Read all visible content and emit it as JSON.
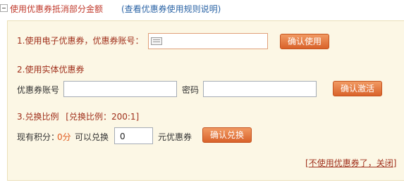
{
  "header": {
    "title": "使用优惠券抵消部分金额",
    "rules_link": "(查看优惠券使用规则说明)"
  },
  "electronic": {
    "label": "1.使用电子优惠券，优惠券账号：",
    "input_value": "",
    "button": "确认使用"
  },
  "physical": {
    "label": "2.使用实体优惠券",
    "account_label": "优惠券账号",
    "password_label": "密码",
    "account_value": "",
    "password_value": "",
    "button": "确认激活"
  },
  "exchange": {
    "label": "3.兑换比例",
    "ratio": "[兑换比例：200:1]",
    "points_prefix": "现有积分：",
    "points_value": "0分",
    "can_exchange": "可以兑换",
    "amount_value": "0",
    "unit": "元优惠券",
    "button": "确认兑换"
  },
  "footer": {
    "open_bracket": "[",
    "link": "不使用优惠券了，关闭",
    "close_bracket": "]"
  },
  "colors": {
    "accent": "#c0392b",
    "link_blue": "#2a63a5",
    "panel_bg": "#fcf7e5",
    "button_orange": "#e07a3e"
  }
}
